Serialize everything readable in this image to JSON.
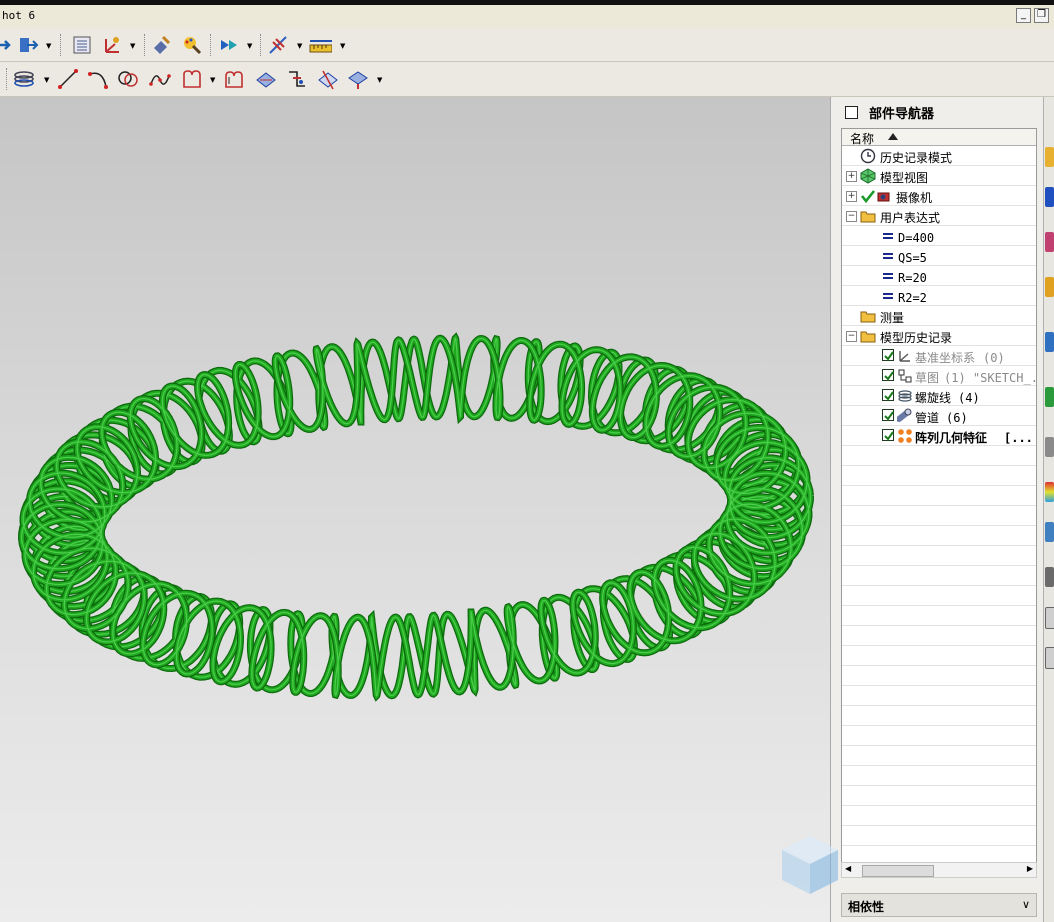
{
  "window": {
    "title": "hot 6"
  },
  "toolbar_row1": {
    "icons": [
      "move-icon",
      "layer-icon",
      "sheet-icon",
      "wcs-icon",
      "edit-object-icon",
      "paint-icon",
      "view-icon",
      "snap-icon",
      "measure-icon"
    ]
  },
  "toolbar_row2": {
    "icons": [
      "helix-icon",
      "line-icon",
      "arc-icon",
      "circle-icon",
      "spline-icon",
      "sketch-icon",
      "offset-curve-icon",
      "sweep-icon",
      "trim-icon",
      "extend-icon",
      "surface-icon"
    ]
  },
  "navigator": {
    "title": "部件导航器",
    "column_name": "名称",
    "rows": [
      {
        "label": "历史记录模式",
        "icon": "clock-icon"
      },
      {
        "label": "模型视图",
        "icon": "model-view-icon"
      },
      {
        "label": "摄像机",
        "icon": "camera-icon"
      },
      {
        "label": "用户表达式",
        "icon": "folder-icon"
      },
      {
        "label": "D=400",
        "icon": "equals-icon"
      },
      {
        "label": "QS=5",
        "icon": "equals-icon"
      },
      {
        "label": "R=20",
        "icon": "equals-icon"
      },
      {
        "label": "R2=2",
        "icon": "equals-icon"
      },
      {
        "label": "测量",
        "icon": "folder-icon"
      },
      {
        "label": "模型历史记录",
        "icon": "folder-icon"
      },
      {
        "label": "基准坐标系",
        "suffix": "(0)",
        "icon": "datum-csys-icon"
      },
      {
        "label": "草图",
        "suffix": "(1) \"SKETCH_...",
        "icon": "sketch-icon"
      },
      {
        "label": "螺旋线",
        "suffix": "(4)",
        "icon": "helix-icon"
      },
      {
        "label": "管道",
        "suffix": "(6)",
        "icon": "tube-icon"
      },
      {
        "label": "阵列几何特征",
        "suffix": "[...",
        "icon": "pattern-icon"
      }
    ]
  },
  "dependencies": {
    "title": "相依性",
    "toggle": "∨"
  },
  "model": {
    "color": "#1fa81f",
    "dark": "#0d6a0d",
    "light": "#5fe05f"
  }
}
